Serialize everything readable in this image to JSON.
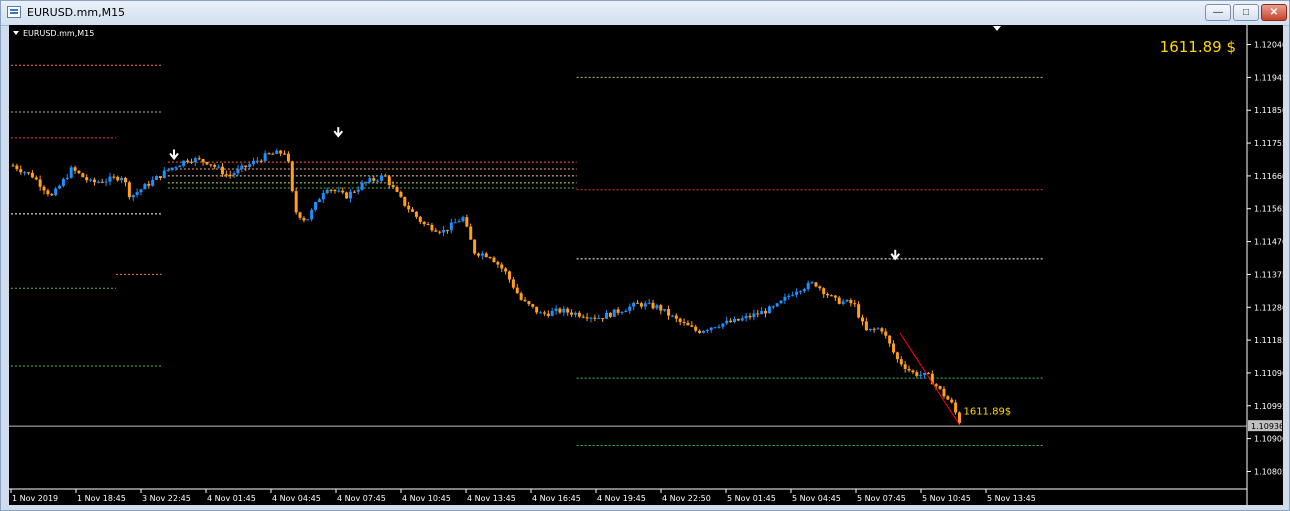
{
  "window": {
    "title": "EURUSD.mm,M15",
    "minimize_glyph": "—",
    "maximize_glyph": "□",
    "close_glyph": "✕"
  },
  "chart_label": "EURUSD.mm,M15",
  "profit_display": "1611.89 $",
  "colors": {
    "background": "#000000",
    "bull": "#1e90ff",
    "bear": "#ff9f1a",
    "profit": "#ffd700",
    "trend_line": "#ff0000"
  },
  "chart_data": {
    "type": "candlestick",
    "symbol": "EURUSD.mm",
    "timeframe": "M15",
    "ylim": [
      1.1076,
      1.12085
    ],
    "y_ticks": [
      "1.12040",
      "1.11945",
      "1.11850",
      "1.11755",
      "1.11660",
      "1.11565",
      "1.11470",
      "1.11375",
      "1.11280",
      "1.11185",
      "1.11090",
      "1.10995",
      "1.10900",
      "1.10805"
    ],
    "current_price": "1.10936",
    "x_ticks": [
      "1 Nov 2019",
      "1 Nov 18:45",
      "3 Nov 22:45",
      "4 Nov 01:45",
      "4 Nov 04:45",
      "4 Nov 07:45",
      "4 Nov 10:45",
      "4 Nov 13:45",
      "4 Nov 16:45",
      "4 Nov 19:45",
      "4 Nov 22:50",
      "5 Nov 01:45",
      "5 Nov 04:45",
      "5 Nov 07:45",
      "5 Nov 10:45",
      "5 Nov 13:45"
    ],
    "price_path": [
      [
        0,
        1.1169
      ],
      [
        5,
        1.1166
      ],
      [
        10,
        1.116
      ],
      [
        15,
        1.1168
      ],
      [
        20,
        1.1164
      ],
      [
        25,
        1.1165
      ],
      [
        28,
        1.1166
      ],
      [
        30,
        1.116
      ],
      [
        35,
        1.1164
      ],
      [
        40,
        1.1168
      ],
      [
        45,
        1.1171
      ],
      [
        50,
        1.117
      ],
      [
        55,
        1.1166
      ],
      [
        60,
        1.1169
      ],
      [
        65,
        1.1172
      ],
      [
        70,
        1.1173
      ],
      [
        72,
        1.1156
      ],
      [
        75,
        1.1153
      ],
      [
        80,
        1.1163
      ],
      [
        85,
        1.116
      ],
      [
        90,
        1.1164
      ],
      [
        95,
        1.1166
      ],
      [
        98,
        1.1161
      ],
      [
        100,
        1.1158
      ],
      [
        105,
        1.1152
      ],
      [
        110,
        1.115
      ],
      [
        115,
        1.1154
      ],
      [
        118,
        1.1144
      ],
      [
        122,
        1.1143
      ],
      [
        126,
        1.1138
      ],
      [
        130,
        1.113
      ],
      [
        135,
        1.1126
      ],
      [
        140,
        1.1127
      ],
      [
        145,
        1.1126
      ],
      [
        150,
        1.1125
      ],
      [
        155,
        1.1127
      ],
      [
        160,
        1.1129
      ],
      [
        165,
        1.1128
      ],
      [
        170,
        1.1124
      ],
      [
        175,
        1.1121
      ],
      [
        180,
        1.1123
      ],
      [
        185,
        1.1124
      ],
      [
        190,
        1.1126
      ],
      [
        195,
        1.1128
      ],
      [
        200,
        1.1133
      ],
      [
        205,
        1.1135
      ],
      [
        207,
        1.1133
      ],
      [
        210,
        1.113
      ],
      [
        215,
        1.1129
      ],
      [
        218,
        1.1121
      ],
      [
        222,
        1.1122
      ],
      [
        226,
        1.1113
      ],
      [
        230,
        1.1109
      ],
      [
        234,
        1.1108
      ],
      [
        237,
        1.1104
      ],
      [
        240,
        1.11
      ],
      [
        242,
        1.1095
      ]
    ],
    "levels": [
      {
        "y": 1.11945,
        "x": [
          0.458,
          0.836
        ],
        "color": "#c8c060"
      },
      {
        "y": 1.1198,
        "x": [
          0,
          0.122
        ],
        "color": "#ff7050"
      },
      {
        "y": 1.11845,
        "x": [
          0,
          0.122
        ],
        "color": "#9acd32"
      },
      {
        "y": 1.1177,
        "x": [
          0,
          0.085
        ],
        "color": "#ff3030"
      },
      {
        "y": 1.117,
        "x": [
          0.127,
          0.458
        ],
        "color": "#ff6040"
      },
      {
        "y": 1.1168,
        "x": [
          0.127,
          0.458
        ],
        "color": "#ffb080"
      },
      {
        "y": 1.1166,
        "x": [
          0.127,
          0.458
        ],
        "color": "#ffd0a0"
      },
      {
        "y": 1.1164,
        "x": [
          0.127,
          0.458
        ],
        "color": "#c8e070"
      },
      {
        "y": 1.11625,
        "x": [
          0.127,
          0.458
        ],
        "color": "#40c040"
      },
      {
        "y": 1.1162,
        "x": [
          0.458,
          0.836
        ],
        "color": "#ff3030"
      },
      {
        "y": 1.1155,
        "x": [
          0,
          0.122
        ],
        "color": "#ffffff"
      },
      {
        "y": 1.1142,
        "x": [
          0.458,
          0.836
        ],
        "color": "#ffffff"
      },
      {
        "y": 1.11375,
        "x": [
          0.085,
          0.122
        ],
        "color": "#ff7050"
      },
      {
        "y": 1.11335,
        "x": [
          0,
          0.085
        ],
        "color": "#40c040"
      },
      {
        "y": 1.1111,
        "x": [
          0,
          0.122
        ],
        "color": "#40c040"
      },
      {
        "y": 1.11075,
        "x": [
          0.458,
          0.836
        ],
        "color": "#40c040"
      },
      {
        "y": 1.1088,
        "x": [
          0.458,
          0.836
        ],
        "color": "#40c040"
      }
    ],
    "arrows": [
      {
        "x": 0.132,
        "price": 1.1169
      },
      {
        "x": 0.265,
        "price": 1.11755
      },
      {
        "x": 0.716,
        "price": 1.114
      }
    ],
    "trade_line": {
      "from": [
        0.72,
        1.11205
      ],
      "to": [
        0.768,
        1.1094
      ]
    },
    "trade_label": "1611.89$"
  }
}
